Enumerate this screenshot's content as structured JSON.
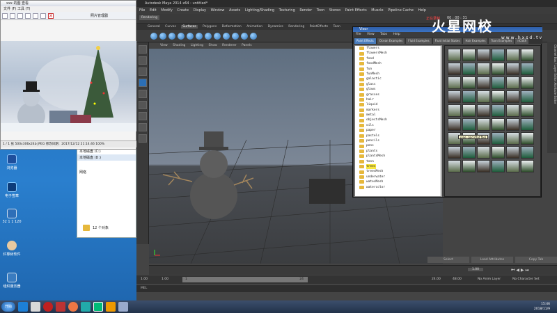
{
  "viewer": {
    "title": "xxx 的图 查看",
    "menu": "文件 (F)   工具 (T)",
    "toolbar_label": "照片管理器",
    "status": "1 / 1 张   500x306x24b JPEG   修改日期：2017/12/12 21:14:46   100%"
  },
  "desktop_icons": [
    {
      "label": "浏览器"
    },
    {
      "label": "电子签章"
    },
    {
      "label": "32 1 1 120"
    },
    {
      "label": "红橡树软件"
    },
    {
      "label": "组织服务器"
    }
  ],
  "explorer": {
    "drive_c": "本地磁盘 (C:)",
    "drive_d": "本地磁盘 (D:)",
    "network": "网络",
    "count": "12 个对象"
  },
  "maya": {
    "title": "Autodesk Maya 2014 x64 : untitled*",
    "menu": [
      "File",
      "Edit",
      "Modify",
      "Create",
      "Display",
      "Window",
      "Assets",
      "Lighting/Shading",
      "Texturing",
      "Render",
      "Toon",
      "Stereo",
      "Paint Effects",
      "Muscle",
      "Pipeline Cache",
      "Help"
    ],
    "mode": "Rendering",
    "status_text": "正在录制",
    "timer": "00 : 00 : 31",
    "shelf_tabs": [
      "General",
      "Curves",
      "Surfaces",
      "Polygons",
      "Deformation",
      "Animation",
      "Dynamics",
      "Rendering",
      "PaintEffects",
      "Toon",
      "Muscle",
      "Fluids",
      "Fur",
      "Hair",
      "nCloth",
      "Custom"
    ],
    "shelf_active": "Surfaces",
    "viewport_menu": [
      "View",
      "Shading",
      "Lighting",
      "Show",
      "Renderer",
      "Panels"
    ],
    "attr_buttons": [
      "Select",
      "Load Attributes",
      "Copy Tab"
    ],
    "side_tabs": "Channel Box / Layer Editor   Attribute Editor",
    "timeline": {
      "start": "1.00",
      "start2": "1.00",
      "frame": "1",
      "end": "24",
      "end2": "24.00",
      "end3": "48.00",
      "anim_layer": "No Anim Layer",
      "char_set": "No Character Set",
      "current": "1.00"
    },
    "cmd_label": "MEL"
  },
  "visor": {
    "title": "Visor",
    "menu": [
      "File",
      "View",
      "Tabs",
      "Help"
    ],
    "tabs": [
      "Paint Effects",
      "Ocean Examples",
      "Fluid Examples",
      "Fluid Initial States",
      "Hair Examples",
      "Toon Examples",
      "nCloth"
    ],
    "active_tab": "Paint Effects",
    "folders": [
      "flowers",
      "flowersMesh",
      "food",
      "foodMesh",
      "fun",
      "funMesh",
      "galactic",
      "glass",
      "glows",
      "grasses",
      "hair",
      "liquid",
      "markers",
      "metal",
      "objectsMesh",
      "oils",
      "paper",
      "pastels",
      "pencils",
      "pens",
      "plants",
      "plantsMesh",
      "toon",
      "trees",
      "treesMesh",
      "underwater",
      "watesMesh",
      "watercolor"
    ],
    "selected": "trees",
    "tooltip": "pine_cold (flat file)"
  },
  "watermark": {
    "big": "火星网校",
    "small": "www.hxsd.tv"
  },
  "taskbar": {
    "start": "开始",
    "time": "15:46",
    "date": "2018/11/9"
  }
}
